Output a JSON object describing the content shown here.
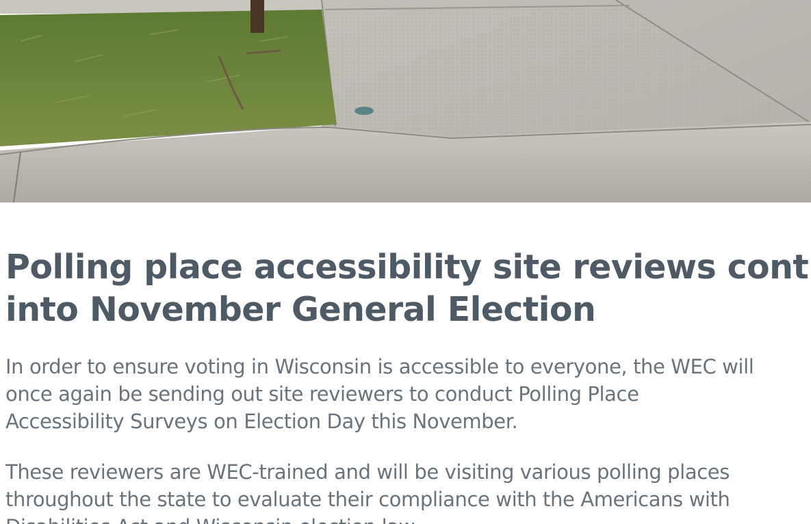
{
  "hero": {
    "icon": "sidewalk-curb-photo"
  },
  "article": {
    "headline_lines": [
      "Polling place accessibility site reviews continue",
      "into November General Election"
    ],
    "paragraph1_lines": [
      "In order to ensure voting in Wisconsin is accessible to everyone, the WEC will",
      "once again be sending out site reviewers to conduct Polling Place",
      "Accessibility Surveys on Election Day this November."
    ],
    "paragraph2_lines": [
      "These reviewers are WEC-trained and will be visiting various polling places",
      "throughout the state to evaluate their compliance with the Americans with",
      "Disabilities Act and Wisconsin election law."
    ]
  },
  "colors": {
    "headline": "#4e5a65",
    "body_text": "#69737c",
    "grass": "#6f8a3c",
    "concrete": "#bdbab4"
  }
}
